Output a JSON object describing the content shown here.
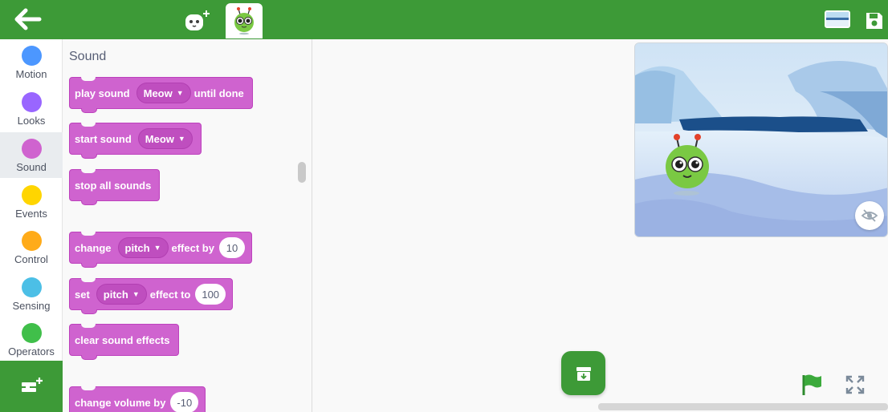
{
  "topbar": {
    "back_icon": "arrow-left-icon",
    "tabs": [
      {
        "name": "add-sprite",
        "icon": "robot-plus-icon"
      },
      {
        "name": "sprite",
        "icon": "green-alien-icon",
        "active": true
      }
    ],
    "stage_thumbnail_icon": "backdrop-thumbnail-icon",
    "save_icon": "save-icon",
    "colors": {
      "bar": "#3d9a37"
    }
  },
  "categories": [
    {
      "label": "Motion",
      "color": "#4c97ff"
    },
    {
      "label": "Looks",
      "color": "#9966ff"
    },
    {
      "label": "Sound",
      "color": "#cf63cf",
      "selected": true
    },
    {
      "label": "Events",
      "color": "#ffd500"
    },
    {
      "label": "Control",
      "color": "#ffab19"
    },
    {
      "label": "Sensing",
      "color": "#4cbfe6"
    },
    {
      "label": "Operators",
      "color": "#40bf4a"
    }
  ],
  "extension_icon": "add-extension-icon",
  "palette": {
    "title": "Sound",
    "blocks": {
      "play_sound": {
        "text1": "play sound",
        "dropdown": "Meow",
        "text2": "until done"
      },
      "start_sound": {
        "text1": "start sound",
        "dropdown": "Meow"
      },
      "stop_all": {
        "text1": "stop all sounds"
      },
      "change_effect": {
        "text1": "change",
        "dropdown": "pitch",
        "text2": "effect by",
        "value": "10"
      },
      "set_effect": {
        "text1": "set",
        "dropdown": "pitch",
        "text2": "effect to",
        "value": "100"
      },
      "clear_effects": {
        "text1": "clear sound effects"
      },
      "change_volume": {
        "text1": "change volume by",
        "value": "-10"
      }
    },
    "block_color": "#cf63cf"
  },
  "stage": {
    "backdrop": "arctic-ice-scene",
    "sprite": "green-alien",
    "hide_icon": "eye-slash-icon"
  },
  "controls": {
    "center_icon": "archive-download-icon",
    "flag_icon": "green-flag-icon",
    "fullscreen_icon": "fullscreen-icon"
  }
}
